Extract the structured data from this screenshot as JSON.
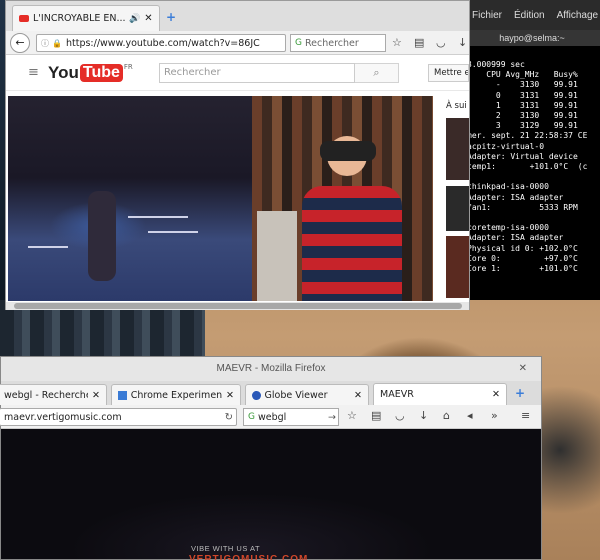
{
  "terminal": {
    "menu": [
      "Fichier",
      "Édition",
      "Affichage"
    ],
    "title": "haypo@selma:~",
    "lines": [
      "3.000999 sec",
      "    CPU Avg_MHz   Busy%",
      "      -    3130   99.91",
      "      0    3131   99.91",
      "      1    3131   99.91",
      "      2    3130   99.91",
      "      3    3129   99.91",
      "mer. sept. 21 22:58:37 CE",
      "acpitz-virtual-0",
      "Adapter: Virtual device",
      "temp1:       +101.0°C  (c",
      "",
      "thinkpad-isa-0000",
      "Adapter: ISA adapter",
      "fan1:          5333 RPM",
      "",
      "coretemp-isa-0000",
      "Adapter: ISA adapter",
      "Physical id 0: +102.0°C",
      "Core 0:         +97.0°C",
      "Core 1:        +101.0°C"
    ]
  },
  "yt_window": {
    "tab_title": "L'INCROYABLE EN...",
    "url": "https://www.youtube.com/watch?v=86JC",
    "search_placeholder": "Rechercher",
    "logo_word": "You",
    "logo_tube": "Tube",
    "logo_region": "FR",
    "yt_search_placeholder": "Rechercher",
    "upload_label": "Mettre en l",
    "side_label": "À sui"
  },
  "mae_window": {
    "title": "MAEVR - Mozilla Firefox",
    "tabs": [
      "webgl - Recherche ...",
      "Chrome Experiment...",
      "Globe Viewer",
      "MAEVR"
    ],
    "url": "maevr.vertigomusic.com",
    "search_value": "webgl",
    "footer_text": "VIBE WITH US AT",
    "footer_brand": "VERTIGOMUSIC.COM"
  },
  "colors": {
    "youtube_red": "#e52d27",
    "firefox_tab": "#f5f5f5",
    "terminal_bg": "#000000"
  }
}
